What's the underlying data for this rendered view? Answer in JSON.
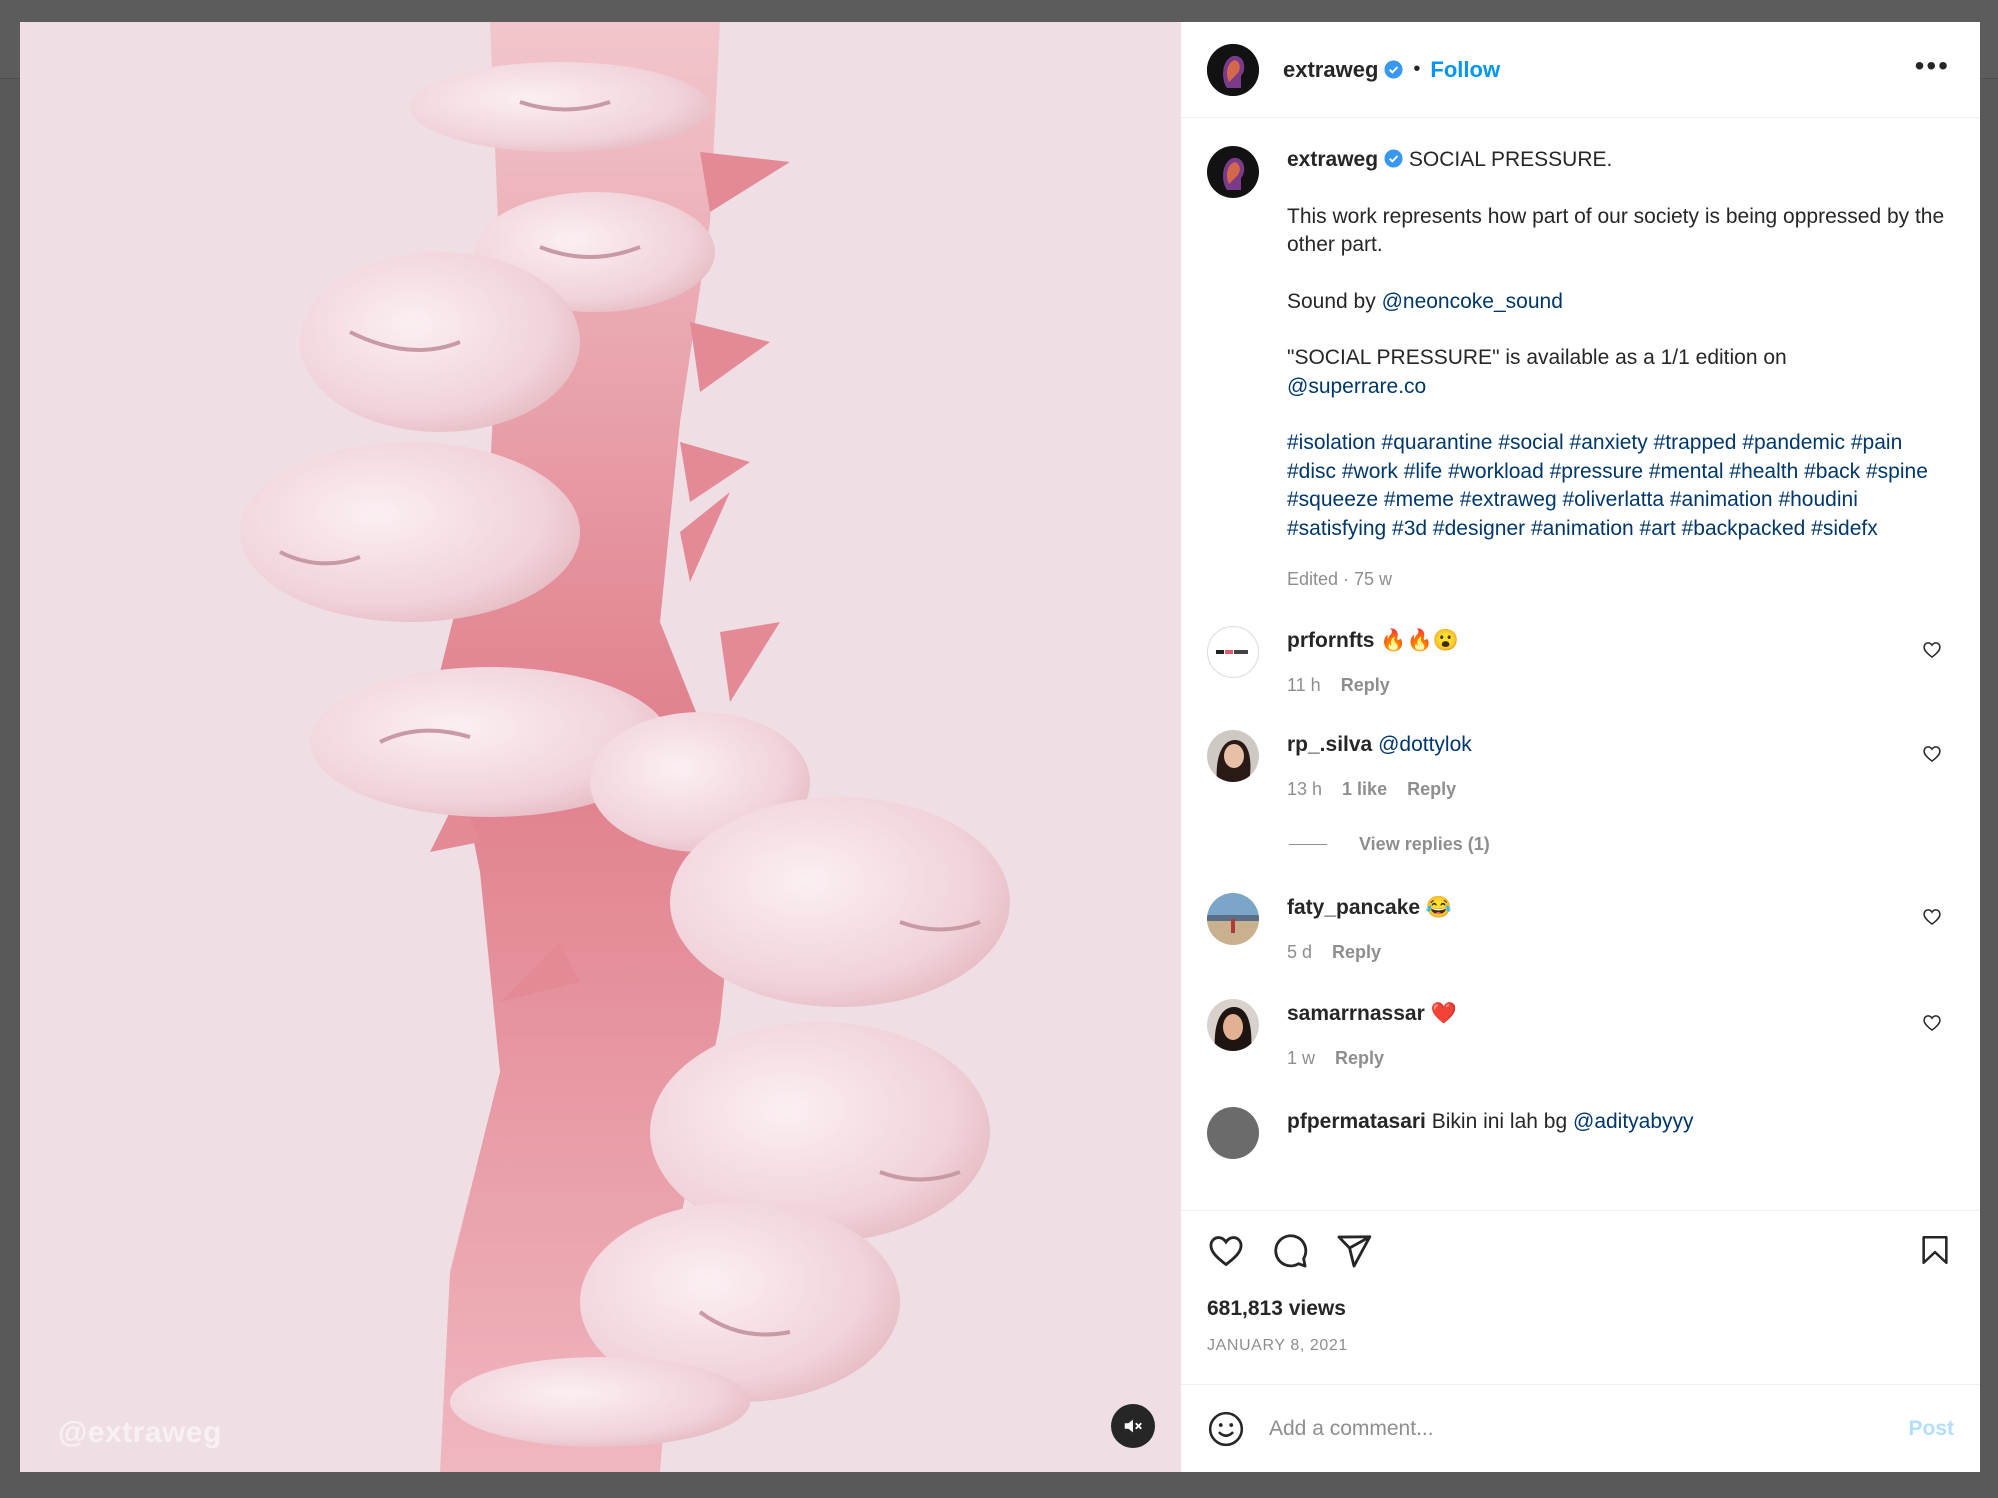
{
  "post": {
    "username": "extraweg",
    "follow_label": "Follow",
    "separator": "•",
    "more_label": "•••",
    "watermark": "@extraweg",
    "caption": {
      "username": "extraweg",
      "title": "SOCIAL PRESSURE.",
      "line1": "This work represents how part of our society is being oppressed by the other part.",
      "sound_prefix": "Sound by ",
      "sound_handle": "@neoncoke_sound",
      "availability": "\"SOCIAL PRESSURE\" is available as a 1/1 edition on",
      "platform_handle": "@superrare.co",
      "hashtags": "#isolation #quarantine #social #anxiety #trapped #pandemic #pain #disc #work #life #workload #pressure #mental #health #back #spine #squeeze #meme #extraweg #oliverlatta #animation #houdini #satisfying #3d #designer #animation #art #backpacked #sidefx",
      "meta": "Edited · 75 w"
    },
    "views": "681,813 views",
    "date": "JANUARY 8, 2021"
  },
  "comments": [
    {
      "user": "prfornfts",
      "text": "🔥🔥😮",
      "time": "11 h",
      "likes": "",
      "reply": "Reply"
    },
    {
      "user": "rp_.silva",
      "text": "@dottylok",
      "time": "13 h",
      "likes": "1 like",
      "reply": "Reply"
    },
    {
      "user": "faty_pancake",
      "text": "😂",
      "time": "5 d",
      "likes": "",
      "reply": "Reply"
    },
    {
      "user": "samarrnassar",
      "text": "❤️",
      "time": "1 w",
      "likes": "",
      "reply": "Reply"
    },
    {
      "user": "pfpermatasari",
      "text": "Bikin ini lah bg",
      "mention": "@adityabyyy"
    }
  ],
  "view_replies": "View replies (1)",
  "add_comment": {
    "placeholder": "Add a comment...",
    "post_label": "Post"
  },
  "colors": {
    "accent": "#0095f6",
    "link": "#00376b",
    "muted": "#8e8e8e",
    "like": "#ed4956"
  },
  "icons": [
    "verified-badge-icon",
    "more-options-icon",
    "heart-icon",
    "comment-icon",
    "share-icon",
    "bookmark-icon",
    "emoji-icon",
    "mute-icon"
  ]
}
